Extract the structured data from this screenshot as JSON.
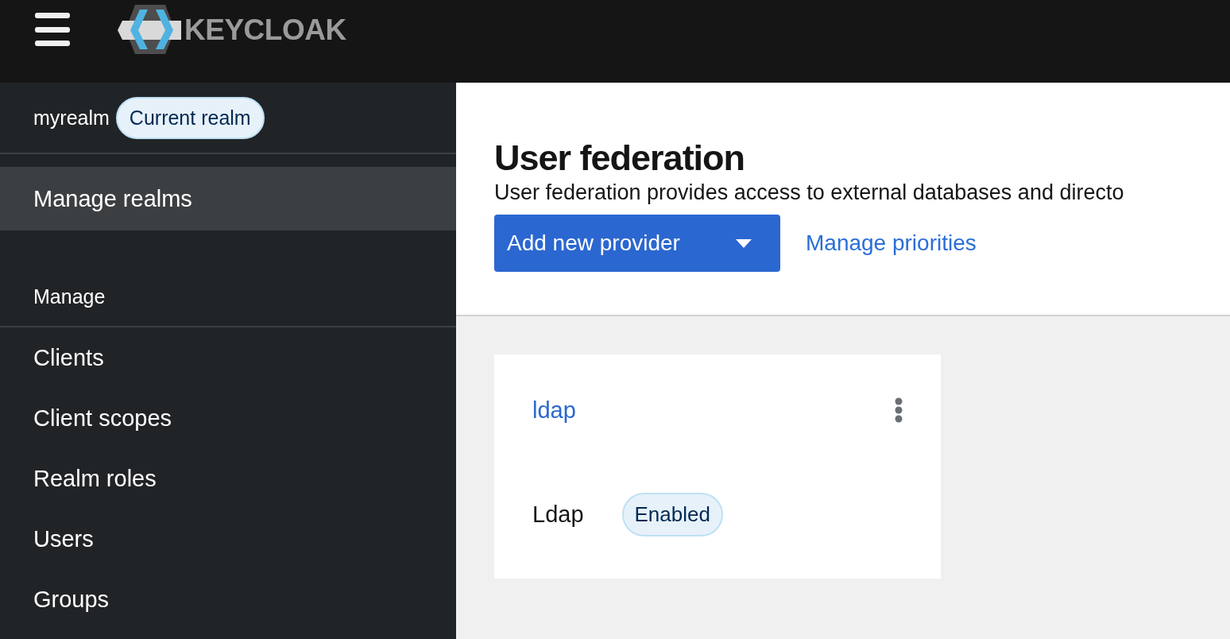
{
  "header": {
    "logo_text": "KEYCLOAK"
  },
  "sidebar": {
    "realm": {
      "name": "myrealm",
      "badge": "Current realm"
    },
    "top_items": [
      {
        "label": "Manage realms",
        "selected": true
      }
    ],
    "section": "Manage",
    "items": [
      {
        "label": "Clients",
        "selected": false
      },
      {
        "label": "Client scopes",
        "selected": false
      },
      {
        "label": "Realm roles",
        "selected": false
      },
      {
        "label": "Users",
        "selected": false
      },
      {
        "label": "Groups",
        "selected": false
      }
    ]
  },
  "page": {
    "title": "User federation",
    "description": "User federation provides access to external databases and directo",
    "primary_button": "Add new provider",
    "link": "Manage priorities"
  },
  "cards": [
    {
      "title": "ldap",
      "type": "Ldap",
      "status": "Enabled",
      "enabled": true
    }
  ]
}
